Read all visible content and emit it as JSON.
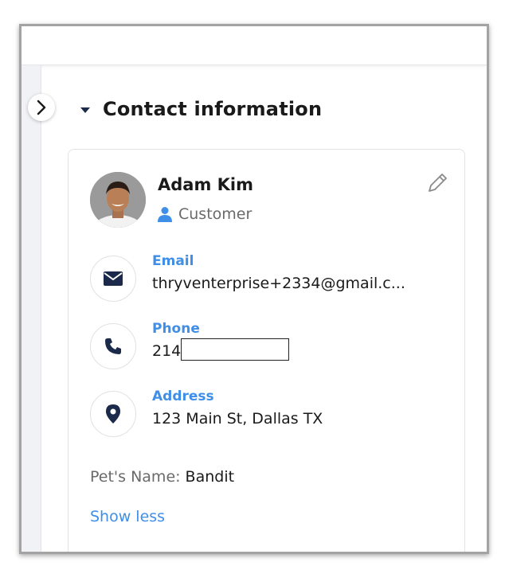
{
  "section": {
    "title": "Contact information"
  },
  "contact": {
    "name": "Adam Kim",
    "role": "Customer",
    "email": {
      "label": "Email",
      "value": "thryventerprise+2334@gmail.c..."
    },
    "phone": {
      "label": "Phone",
      "value_prefix": "214"
    },
    "address": {
      "label": "Address",
      "value": "123 Main St, Dallas TX"
    },
    "custom_fields": [
      {
        "label": "Pet's Name:",
        "value": "Bandit"
      }
    ],
    "show_less": "Show less"
  },
  "icons": {
    "toggle": "chevron-right-icon",
    "section_caret": "caret-down-icon",
    "role": "person-icon",
    "edit": "pencil-icon",
    "email": "envelope-icon",
    "phone": "phone-icon",
    "address": "map-pin-icon"
  },
  "colors": {
    "accent": "#3f8ee8",
    "icon_dark": "#1b2a4a",
    "muted": "#6a6a6a"
  }
}
